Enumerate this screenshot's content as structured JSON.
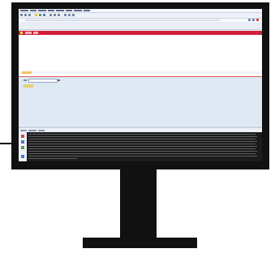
{
  "monitor": {
    "screen": {
      "menu_items": [
        "",
        "",
        "",
        "",
        "",
        "",
        "",
        ""
      ],
      "toolbar_buttons": [
        "toolbar",
        "toolbar",
        "toolbar",
        "yellow",
        "green",
        "blue",
        "toolbar",
        "toolbar",
        "toolbar",
        "toolbar",
        "toolbar",
        "toolbar"
      ],
      "address_value": "",
      "red_bar_tabs": [
        "",
        ""
      ],
      "section_tab_label": "",
      "form_label": "",
      "form_input_value": "",
      "form_button_label": "",
      "bottom_tabs": [
        "",
        "",
        ""
      ],
      "console_lines": [
        "",
        "",
        "",
        "",
        "",
        "",
        "",
        "",
        "",
        "",
        "",
        ""
      ],
      "side_icons": [
        "red",
        "blue",
        "green",
        "blue"
      ]
    }
  }
}
